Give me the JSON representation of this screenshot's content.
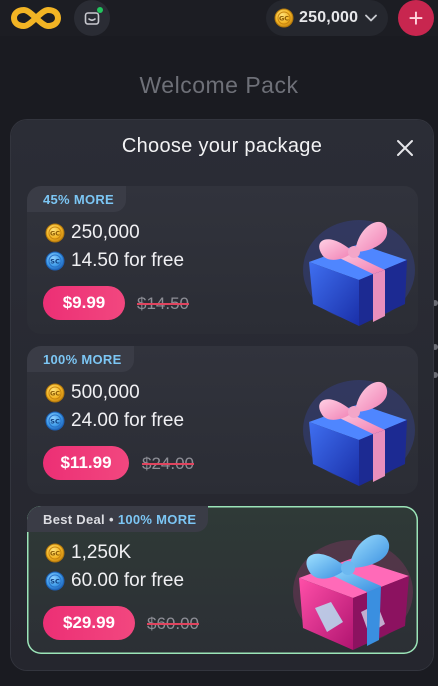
{
  "topbar": {
    "balance": "250,000",
    "add_label": "+"
  },
  "page": {
    "title": "Welcome Pack"
  },
  "modal": {
    "title": "Choose your package",
    "packages": [
      {
        "badge": "45% MORE",
        "gold_amount": "250,000",
        "sweeps_amount": "14.50 for free",
        "price": "$9.99",
        "old_price": "$14.50"
      },
      {
        "badge": "100% MORE",
        "gold_amount": "500,000",
        "sweeps_amount": "24.00 for free",
        "price": "$11.99",
        "old_price": "$24.00"
      },
      {
        "badge_prefix": "Best Deal",
        "badge_separator": "•",
        "badge": "100% MORE",
        "gold_amount": "1,250K",
        "sweeps_amount": "60.00 for free",
        "price": "$29.99",
        "old_price": "$60.00"
      }
    ]
  },
  "icons": {
    "gold_coin": "GC",
    "sweeps_coin": "SC"
  },
  "colors": {
    "accent_pink": "#ec2f75",
    "badge_blue": "#7cc6f4",
    "best_border": "#9be4b8",
    "gold": "#f2b424",
    "sweeps": "#3d9be9"
  }
}
